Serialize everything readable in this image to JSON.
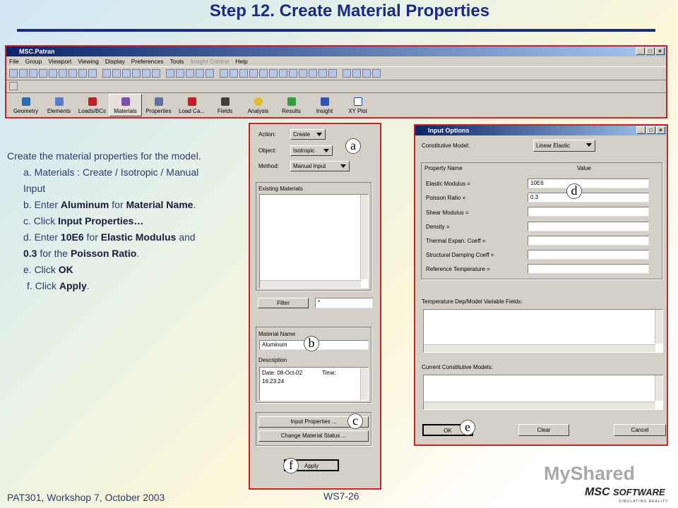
{
  "slide": {
    "title": "Step 12.  Create Material Properties",
    "footer_left": "PAT301, Workshop 7, October 2003",
    "footer_center": "WS7-26",
    "logo_watermark": "MyShared",
    "logo_brand": "MSC",
    "logo_brand2": "SOFTWARE",
    "logo_tagline": "SIMULATING REALITY"
  },
  "instructions": {
    "intro": "Create the material properties for the model.",
    "a": "a.  Materials : Create / Isotropic / Manual Input",
    "b_pre": "b.  Enter ",
    "b_bold1": "Aluminum",
    "b_mid": " for ",
    "b_bold2": "Material Name",
    "b_end": ".",
    "c_pre": "c.  Click ",
    "c_bold": "Input Properties…",
    "d_pre": "d.  Enter ",
    "d_bold1": "10E6",
    "d_mid1": " for ",
    "d_bold2": "Elastic Modulus",
    "d_mid2": " and ",
    "d_bold3": "0.3",
    "d_mid3": " for the ",
    "d_bold4": "Poisson Ratio",
    "d_end": ".",
    "e_pre": "e.  Click ",
    "e_bold": "OK",
    "f_pre": "f.  Click ",
    "f_bold": "Apply",
    "f_end": "."
  },
  "patran": {
    "title": "MSC.Patran",
    "menu": [
      "File",
      "Group",
      "Viewport",
      "Viewing",
      "Display",
      "Preferences",
      "Tools",
      "Insight Control",
      "Help"
    ],
    "apps": [
      "Geometry",
      "Elements",
      "Loads/BCs",
      "Materials",
      "Properties",
      "Load Ca...",
      "Fields",
      "Analysis",
      "Results",
      "Insight",
      "XY Plot"
    ]
  },
  "materials_panel": {
    "action_label": "Action:",
    "action_value": "Create",
    "object_label": "Object:",
    "object_value": "Isotropic",
    "method_label": "Method:",
    "method_value": "Manual Input",
    "existing_label": "Existing Materials",
    "filter_button": "Filter",
    "filter_value": "*",
    "name_label": "Material Name",
    "name_value": "Aluminum",
    "desc_label": "Description",
    "desc_date": "Date: 08-Oct-02",
    "desc_time_label": "Time:",
    "desc_time": "16:23:24",
    "input_props_button": "Input Properties ...",
    "change_status_button": "Change Material Status ...",
    "apply_button": "Apply"
  },
  "input_options": {
    "title": "Input Options",
    "model_label": "Constitutive Model:",
    "model_value": "Linear Elastic",
    "col_name": "Property Name",
    "col_value": "Value",
    "properties": [
      {
        "name": "Elastic Modulus =",
        "value": "10E6"
      },
      {
        "name": "Poisson Ratio =",
        "value": "0.3"
      },
      {
        "name": "Shear Modulus =",
        "value": ""
      },
      {
        "name": "Density =",
        "value": ""
      },
      {
        "name": "Thermal Expan. Coeff =",
        "value": ""
      },
      {
        "name": "Structural Damping Coeff =",
        "value": ""
      },
      {
        "name": "Reference Temperature =",
        "value": ""
      }
    ],
    "temp_label": "Temperature Dep/Model Variable Fields:",
    "current_label": "Current Constitutive Models:",
    "ok": "OK",
    "clear": "Clear",
    "cancel": "Cancel"
  },
  "callouts": {
    "a": "a",
    "b": "b",
    "c": "c",
    "d": "d",
    "e": "e",
    "f": "f"
  },
  "colors": {
    "title": "#1a2a8a",
    "highlight": "#cc2222",
    "titlebar": "#0a246a"
  }
}
